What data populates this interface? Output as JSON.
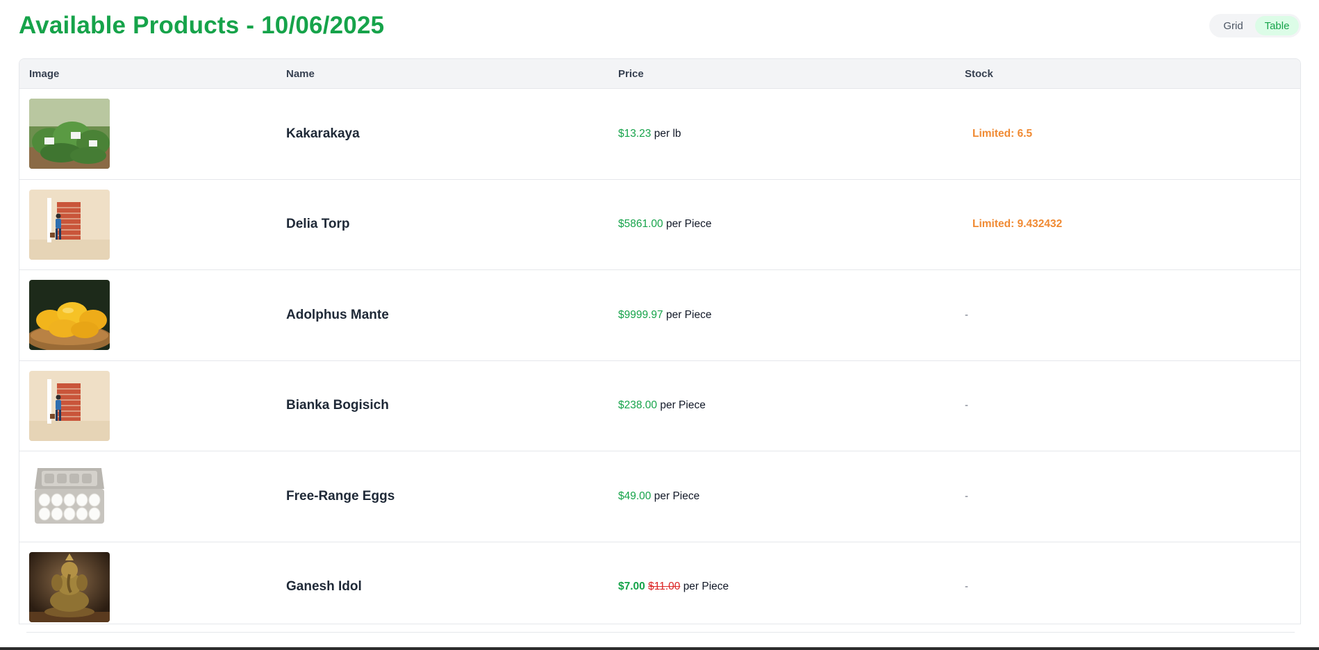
{
  "page": {
    "title": "Available Products - 10/06/2025"
  },
  "view_toggle": {
    "grid_label": "Grid",
    "table_label": "Table",
    "active": "Table"
  },
  "table": {
    "headers": {
      "image": "Image",
      "name": "Name",
      "price": "Price",
      "stock": "Stock"
    },
    "rows": [
      {
        "name": "Kakarakaya",
        "price": "$13.23",
        "unit": "per lb",
        "stock": "Limited: 6.5",
        "image": "bitter-gourd-bags-photo"
      },
      {
        "name": "Delia Torp",
        "price": "$5861.00",
        "unit": "per Piece",
        "stock": "Limited: 9.432432",
        "image": "placeholder-illustration"
      },
      {
        "name": "Adolphus Mante",
        "price": "$9999.97",
        "unit": "per Piece",
        "stock": "-",
        "image": "mangoes-basket-photo"
      },
      {
        "name": "Bianka Bogisich",
        "price": "$238.00",
        "unit": "per Piece",
        "stock": "-",
        "image": "placeholder-illustration"
      },
      {
        "name": "Free-Range Eggs",
        "price": "$49.00",
        "unit": "per Piece",
        "stock": "-",
        "image": "egg-carton-photo"
      },
      {
        "name": "Ganesh Idol",
        "price": "$7.00",
        "old_price": "$11.00",
        "unit": "per Piece",
        "stock": "-",
        "image": "ganesh-idol-photo"
      }
    ]
  },
  "colors": {
    "brand_green": "#16a34a",
    "limited_orange": "#f08a33",
    "strike_red": "#dc2626"
  }
}
